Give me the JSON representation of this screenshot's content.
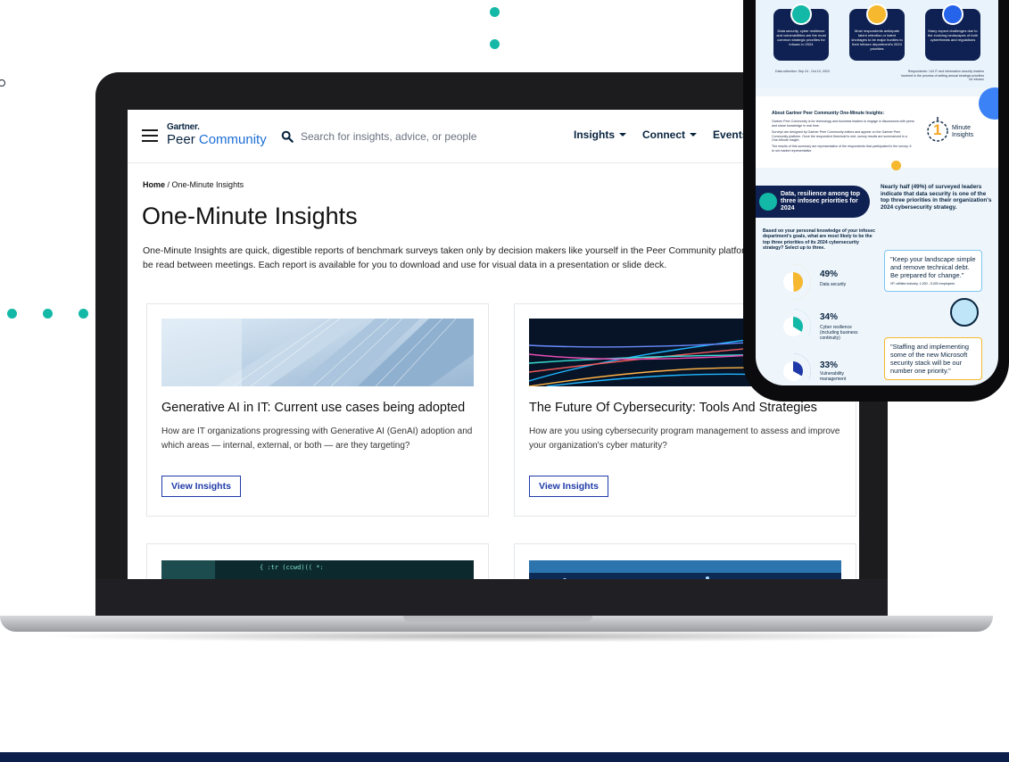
{
  "site": {
    "logo_top": "Gartner.",
    "logo_peer": "Peer ",
    "logo_community": "Community",
    "search_placeholder": "Search for insights, advice, or people",
    "nav": [
      {
        "label": "Insights"
      },
      {
        "label": "Connect"
      },
      {
        "label": "Events"
      }
    ]
  },
  "breadcrumb": {
    "home": "Home",
    "sep": " / ",
    "current": "One-Minute Insights"
  },
  "page": {
    "title": "One-Minute Insights",
    "intro": "One-Minute Insights are quick, digestible reports of benchmark surveys taken only by decision makers like yourself in the Peer Community platfor designed to be read between meetings. Each report is available for you to download and use for visual data in a presentation or slide deck."
  },
  "cards": [
    {
      "title": "Generative AI in IT: Current use cases being adopted",
      "description": "How are IT organizations progressing with Generative AI (GenAI) adoption and which areas — internal, external, or both — are they targeting?",
      "button": "View Insights"
    },
    {
      "title": "The Future Of Cybersecurity: Tools And Strategies",
      "description": "How are you using cybersecurity program management to assess and improve your organization's cyber maturity?",
      "button": "View Insights"
    }
  ],
  "phone": {
    "boxes": [
      {
        "caption": "Data security, cyber resilience and vulnerabilities are the most common strategic priorities for infosec in 2024"
      },
      {
        "caption": "Most respondents anticipate talent retention or talent shortages to be major hurdles to their infosec department's 2024 priorities"
      },
      {
        "caption": "Many expect challenges due to the evolving landscapes of both cyberthreats and regulations"
      }
    ],
    "data_collection": "Data collection: Sep 24 - Oct 10, 2023",
    "respondents": "Respondents: 144 IT and information security leaders involved in the process of setting annual strategic priorities for infosec",
    "about_title": "About Gartner Peer Community One-Minute Insights:",
    "about_p1": "Gartner Peer Community is for technology and business leaders to engage in discussions with peers and share knowledge in real time.",
    "about_p2": "Surveys are designed by Gartner Peer Community editors and appear on the Gartner Peer Community platform. Once the respondent threshold is met, survey results are summarized in a One-Minute Insight.",
    "about_p3": "The results of this summary are representative of the respondents that participated in the survey. It is not market representative.",
    "mi_number": "1",
    "mi_label": "Minute Insights",
    "band_text": "Data, resilience among top three infosec priorities for 2024",
    "side_text": "Nearly half (49%) of surveyed leaders indicate that data security is one of the top three priorities in their organization's 2024 cybersecurity strategy.",
    "question": "Based on your personal knowledge of your infosec department's goals, what are most likely to be the top three priorities of its 2024 cybersecurity strategy? Select up to three.",
    "stats": [
      {
        "pct": "49%",
        "label": "Data security",
        "value": 49
      },
      {
        "pct": "34%",
        "label": "Cyber resilience (including business continuity)",
        "value": 34
      },
      {
        "pct": "33%",
        "label": "Vulnerability management",
        "value": 33
      }
    ],
    "quote1": "\"Keep your landscape simple and remove technical debt. Be prepared for change.\"",
    "quote1_attr": "VP, utilities industry, 1,000 - 5,000 employees",
    "quote2": "\"Staffing and implementing some of the new Microsoft security stack will be our number one priority.\""
  },
  "colors": {
    "teal": "#14b8a6",
    "navy": "#0f2152",
    "brand_blue": "#1f3aa8",
    "yellow": "#f5b82e",
    "footer": "#0c1f4a"
  }
}
